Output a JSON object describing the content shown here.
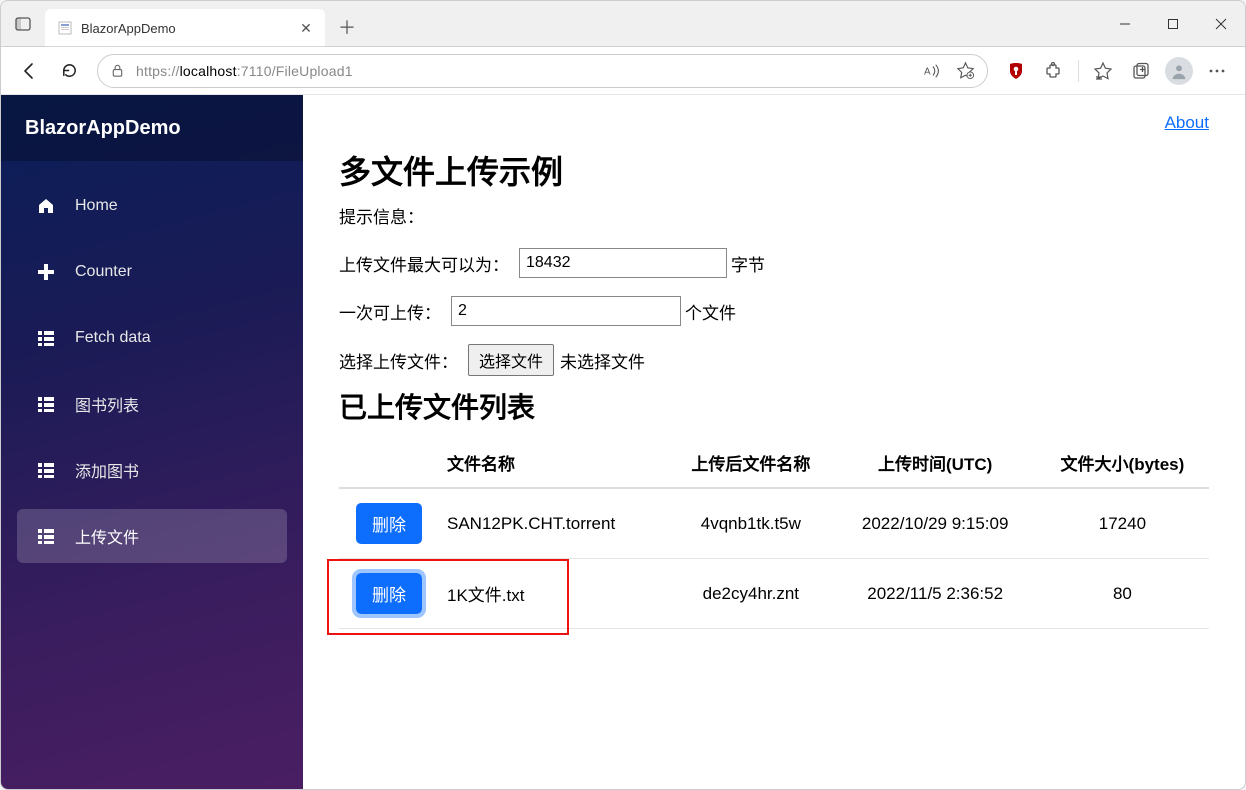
{
  "browser": {
    "tab_title": "BlazorAppDemo",
    "url_prefix": "https://",
    "url_host": "localhost",
    "url_port": ":7110",
    "url_path": "/FileUpload1"
  },
  "app": {
    "brand": "BlazorAppDemo",
    "about": "About"
  },
  "sidebar": {
    "items": [
      {
        "label": "Home"
      },
      {
        "label": "Counter"
      },
      {
        "label": "Fetch data"
      },
      {
        "label": "图书列表"
      },
      {
        "label": "添加图书"
      },
      {
        "label": "上传文件"
      }
    ]
  },
  "page": {
    "heading": "多文件上传示例",
    "message_label": "提示信息：",
    "max_label": "上传文件最大可以为：",
    "max_value": "18432",
    "max_suffix": "字节",
    "count_label": "一次可上传：",
    "count_value": "2",
    "count_suffix": "个文件",
    "select_label": "选择上传文件：",
    "choose_button": "选择文件",
    "no_file": "未选择文件",
    "list_heading": "已上传文件列表"
  },
  "table": {
    "headers": {
      "action": "",
      "name": "文件名称",
      "stored": "上传后文件名称",
      "time": "上传时间(UTC)",
      "size": "文件大小(bytes)"
    },
    "delete_label": "删除",
    "rows": [
      {
        "name": "SAN12PK.CHT.torrent",
        "stored": "4vqnb1tk.t5w",
        "time": "2022/10/29 9:15:09",
        "size": "17240"
      },
      {
        "name": "1K文件.txt",
        "stored": "de2cy4hr.znt",
        "time": "2022/11/5 2:36:52",
        "size": "80"
      }
    ]
  }
}
